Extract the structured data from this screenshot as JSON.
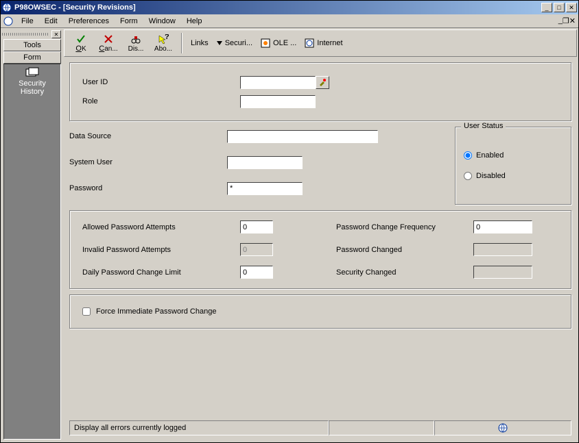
{
  "window": {
    "title": "P98OWSEC - [Security Revisions]"
  },
  "menu": {
    "file": "File",
    "edit": "Edit",
    "preferences": "Preferences",
    "form": "Form",
    "window": "Window",
    "help": "Help"
  },
  "tb": {
    "ok": "OK",
    "cancel": "Can...",
    "dis": "Dis...",
    "about": "Abo...",
    "links": "Links",
    "security": "Securi...",
    "ole": "OLE ...",
    "internet": "Internet"
  },
  "sidebar": {
    "tools": "Tools",
    "form": "Form",
    "sec_history": "Security\nHistory"
  },
  "form": {
    "user_id_label": "User ID",
    "user_id_value": "",
    "role_label": "Role",
    "role_value": "",
    "data_source_label": "Data Source",
    "data_source_value": "",
    "system_user_label": "System User",
    "system_user_value": "",
    "password_label": "Password",
    "password_value": "*",
    "user_status_title": "User Status",
    "enabled_label": "Enabled",
    "disabled_label": "Disabled",
    "allowed_attempts_label": "Allowed Password Attempts",
    "allowed_attempts_value": "0",
    "invalid_attempts_label": "Invalid Password Attempts",
    "invalid_attempts_value": "0",
    "daily_limit_label": "Daily Password Change Limit",
    "daily_limit_value": "0",
    "change_freq_label": "Password Change Frequency",
    "change_freq_value": "0",
    "pw_changed_label": "Password Changed",
    "pw_changed_value": "",
    "sec_changed_label": "Security Changed",
    "sec_changed_value": "",
    "force_label": "Force Immediate Password Change"
  },
  "status": {
    "msg": "Display all errors currently logged"
  }
}
